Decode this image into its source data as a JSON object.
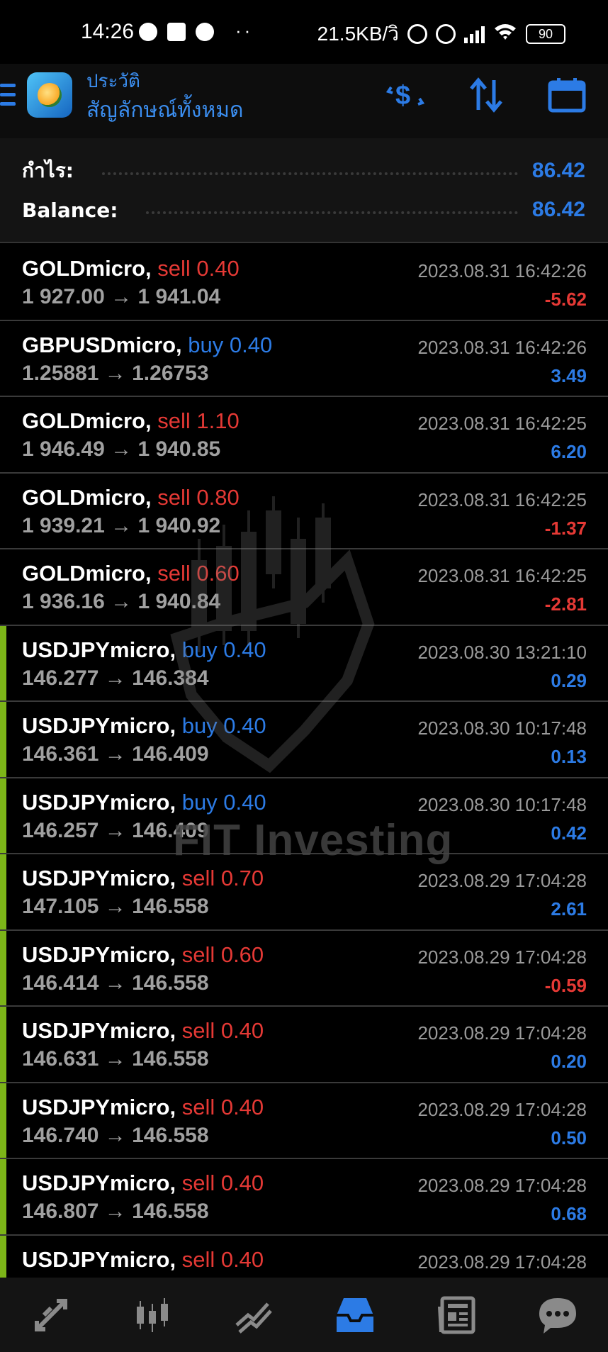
{
  "status_bar": {
    "time": "14:26",
    "net_speed": "21.5KB/วิ",
    "battery": "90"
  },
  "header": {
    "subtitle": "ประวัติ",
    "title": "สัญลักษณ์ทั้งหมด"
  },
  "summary": {
    "profit_label": "กำไร:",
    "profit_value": "86.42",
    "balance_label": "Balance:",
    "balance_value": "86.42"
  },
  "trades": [
    {
      "symbol": "GOLDmicro,",
      "side": "sell",
      "volume": "sell 0.40",
      "prices": "1 927.00 → 1 941.04",
      "time": "2023.08.31 16:42:26",
      "profit": "-5.62",
      "accent": false
    },
    {
      "symbol": "GBPUSDmicro,",
      "side": "buy",
      "volume": "buy 0.40",
      "prices": "1.25881 → 1.26753",
      "time": "2023.08.31 16:42:26",
      "profit": "3.49",
      "accent": false
    },
    {
      "symbol": "GOLDmicro,",
      "side": "sell",
      "volume": "sell 1.10",
      "prices": "1 946.49 → 1 940.85",
      "time": "2023.08.31 16:42:25",
      "profit": "6.20",
      "accent": false
    },
    {
      "symbol": "GOLDmicro,",
      "side": "sell",
      "volume": "sell 0.80",
      "prices": "1 939.21 → 1 940.92",
      "time": "2023.08.31 16:42:25",
      "profit": "-1.37",
      "accent": false
    },
    {
      "symbol": "GOLDmicro,",
      "side": "sell",
      "volume": "sell 0.60",
      "prices": "1 936.16 → 1 940.84",
      "time": "2023.08.31 16:42:25",
      "profit": "-2.81",
      "accent": false
    },
    {
      "symbol": "USDJPYmicro,",
      "side": "buy",
      "volume": "buy 0.40",
      "prices": "146.277 → 146.384",
      "time": "2023.08.30 13:21:10",
      "profit": "0.29",
      "accent": true
    },
    {
      "symbol": "USDJPYmicro,",
      "side": "buy",
      "volume": "buy 0.40",
      "prices": "146.361 → 146.409",
      "time": "2023.08.30 10:17:48",
      "profit": "0.13",
      "accent": true
    },
    {
      "symbol": "USDJPYmicro,",
      "side": "buy",
      "volume": "buy 0.40",
      "prices": "146.257 → 146.409",
      "time": "2023.08.30 10:17:48",
      "profit": "0.42",
      "accent": true
    },
    {
      "symbol": "USDJPYmicro,",
      "side": "sell",
      "volume": "sell 0.70",
      "prices": "147.105 → 146.558",
      "time": "2023.08.29 17:04:28",
      "profit": "2.61",
      "accent": true
    },
    {
      "symbol": "USDJPYmicro,",
      "side": "sell",
      "volume": "sell 0.60",
      "prices": "146.414 → 146.558",
      "time": "2023.08.29 17:04:28",
      "profit": "-0.59",
      "accent": true
    },
    {
      "symbol": "USDJPYmicro,",
      "side": "sell",
      "volume": "sell 0.40",
      "prices": "146.631 → 146.558",
      "time": "2023.08.29 17:04:28",
      "profit": "0.20",
      "accent": true
    },
    {
      "symbol": "USDJPYmicro,",
      "side": "sell",
      "volume": "sell 0.40",
      "prices": "146.740 → 146.558",
      "time": "2023.08.29 17:04:28",
      "profit": "0.50",
      "accent": true
    },
    {
      "symbol": "USDJPYmicro,",
      "side": "sell",
      "volume": "sell 0.40",
      "prices": "146.807 → 146.558",
      "time": "2023.08.29 17:04:28",
      "profit": "0.68",
      "accent": true
    },
    {
      "symbol": "USDJPYmicro,",
      "side": "sell",
      "volume": "sell 0.40",
      "prices": "",
      "time": "2023.08.29 17:04:28",
      "profit": "",
      "accent": true
    }
  ],
  "watermark": {
    "text": "FIT Investing"
  },
  "bottom_nav": [
    {
      "icon": "quotes-icon"
    },
    {
      "icon": "chart-icon"
    },
    {
      "icon": "trade-icon"
    },
    {
      "icon": "history-icon",
      "active": true
    },
    {
      "icon": "news-icon"
    },
    {
      "icon": "chat-icon"
    }
  ],
  "colors": {
    "accent": "#2c7be5",
    "sell": "#e53935",
    "buy": "#2c7be5",
    "row_marker": "#7cb518"
  }
}
